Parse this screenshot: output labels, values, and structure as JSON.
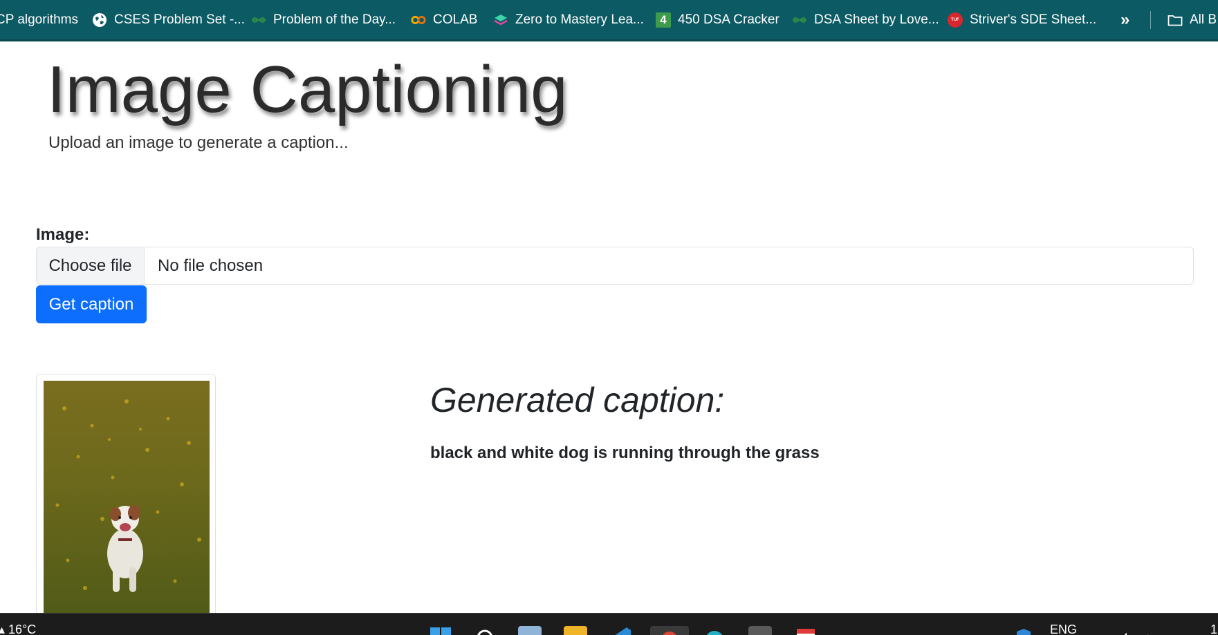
{
  "bookmarks": [
    {
      "label": "CP algorithms",
      "icon": "generic-page-icon"
    },
    {
      "label": "CSES Problem Set -...",
      "icon": "globe-icon"
    },
    {
      "label": "Problem of the Day...",
      "icon": "gfg-icon"
    },
    {
      "label": "COLAB",
      "icon": "colab-icon"
    },
    {
      "label": "Zero to Mastery Lea...",
      "icon": "ztm-icon"
    },
    {
      "label": "450 DSA Cracker",
      "icon": "number-four-icon",
      "badge": "4"
    },
    {
      "label": "DSA Sheet by Love...",
      "icon": "gfg-icon"
    },
    {
      "label": "Striver's SDE Sheet...",
      "icon": "tuf-icon",
      "badge": "TUF"
    }
  ],
  "bookmarks_more": "»",
  "all_bookmarks": "All B",
  "page": {
    "title": "Image Captioning",
    "subtitle": "Upload an image to generate a caption...",
    "image_label": "Image:",
    "choose_file": "Choose file",
    "file_status": "No file chosen",
    "submit_label": "Get caption",
    "caption_heading": "Generated caption:",
    "caption_text": "black and white dog is running through the grass"
  },
  "taskbar": {
    "weather": "16°C",
    "language": "ENG",
    "clock_partial": "1"
  },
  "colors": {
    "bookmarks_bg": "#0c5a63",
    "primary_button": "#0d6efd",
    "taskbar_bg": "#1c1c1c"
  }
}
